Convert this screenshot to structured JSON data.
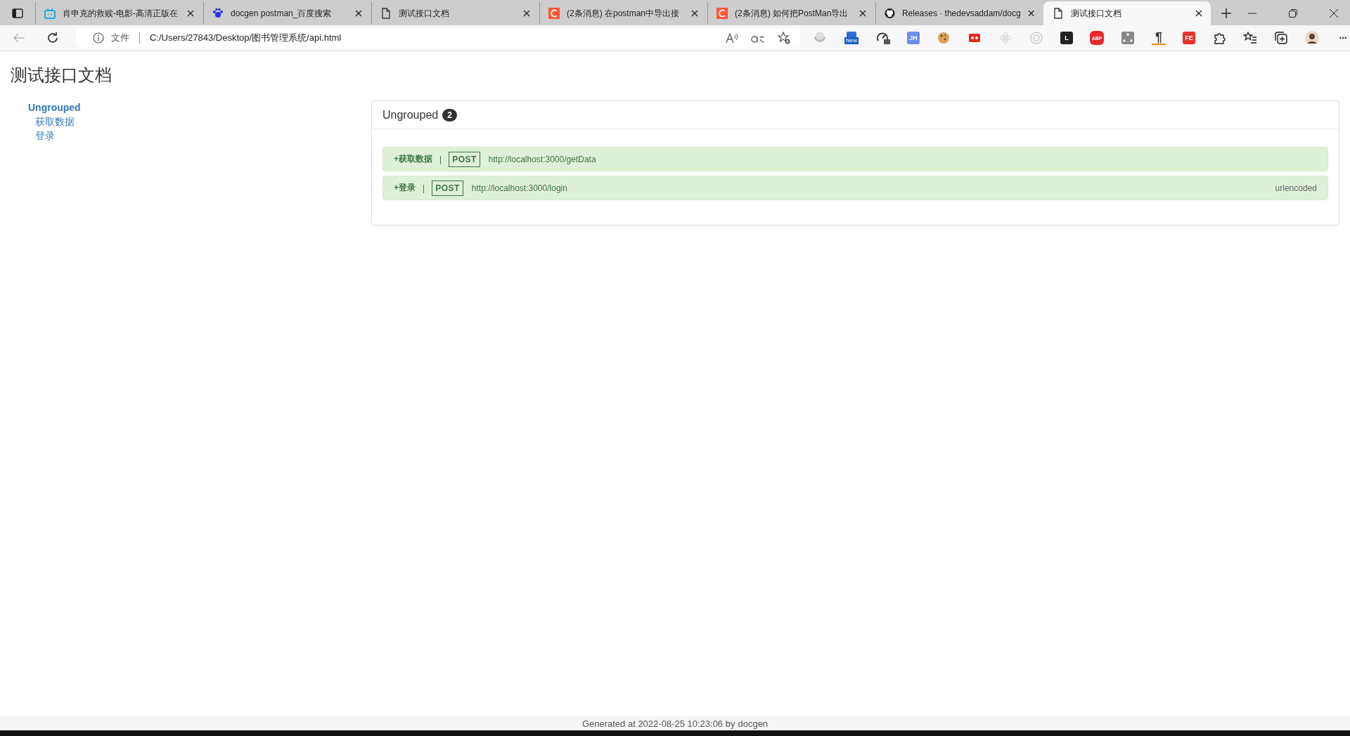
{
  "browser": {
    "tabs": [
      {
        "title": "肖申克的救赎-电影-高清正版在",
        "kind": "tv",
        "selected": false
      },
      {
        "title": "docgen postman_百度搜索",
        "kind": "paw",
        "selected": false
      },
      {
        "title": "测试接口文档",
        "kind": "page",
        "selected": false
      },
      {
        "title": "(2条消息) 在postman中导出接",
        "kind": "c-logo",
        "selected": false
      },
      {
        "title": "(2条消息) 如何把PostMan导出",
        "kind": "c-logo",
        "selected": false
      },
      {
        "title": "Releases · thedevsaddam/docg",
        "kind": "github",
        "selected": false
      },
      {
        "title": "测试接口文档",
        "kind": "page",
        "selected": true
      }
    ],
    "address": {
      "security_label": "文件",
      "url": "C:/Users/27843/Desktop/图书管理系统/api.html"
    },
    "extensions": [
      {
        "kind": "shell"
      },
      {
        "kind": "badge",
        "label": "New"
      },
      {
        "kind": "gauge"
      },
      {
        "kind": "tile",
        "label": "JH",
        "color": "#6b8cf0"
      },
      {
        "kind": "cookie"
      },
      {
        "kind": "dots"
      },
      {
        "kind": "atom"
      },
      {
        "kind": "ring"
      },
      {
        "kind": "tile",
        "label": "L",
        "color": "#222222"
      },
      {
        "kind": "octagon",
        "label": "ABP"
      },
      {
        "kind": "tree"
      },
      {
        "kind": "pilcrow",
        "label": "¶"
      },
      {
        "kind": "tile",
        "label": "FE",
        "color": "#e8302a"
      },
      {
        "kind": "puzzle"
      },
      {
        "kind": "favorites"
      },
      {
        "kind": "collections"
      },
      {
        "kind": "avatar"
      },
      {
        "kind": "more",
        "label": "···"
      }
    ]
  },
  "page": {
    "title": "测试接口文档",
    "sidebar": {
      "group": "Ungrouped",
      "items": [
        "获取数据",
        "登录"
      ]
    },
    "panel": {
      "title": "Ungrouped",
      "count": "2",
      "endpoints": [
        {
          "name": "+获取数据",
          "separator": "|",
          "method": "POST",
          "url": "http://localhost:3000/getData"
        },
        {
          "name": "+登录",
          "separator": "|",
          "method": "POST",
          "url": "http://localhost:3000/login",
          "body_type": "urlencoded"
        }
      ]
    },
    "footer": {
      "text": "Generated at 2022-08-25 10:23:06 by",
      "link": "docgen"
    }
  }
}
